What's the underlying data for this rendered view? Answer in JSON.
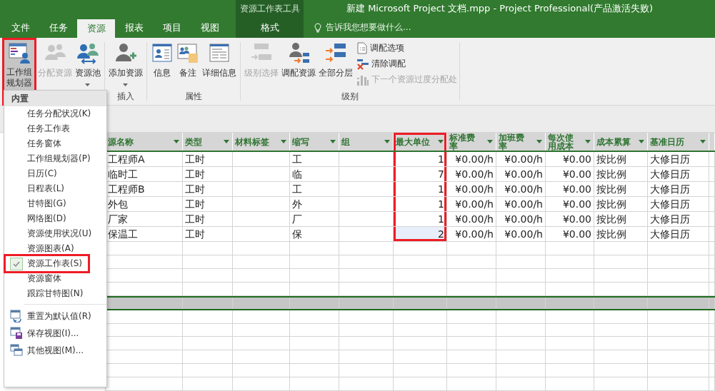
{
  "window": {
    "title": "新建 Microsoft Project 文档.mpp - Project Professional(产品激活失败)",
    "contextual_title": "资源工作表工具"
  },
  "tabs": [
    {
      "label": "文件",
      "selected": false,
      "contextual": false
    },
    {
      "label": "任务",
      "selected": false,
      "contextual": false
    },
    {
      "label": "资源",
      "selected": true,
      "contextual": false
    },
    {
      "label": "报表",
      "selected": false,
      "contextual": false
    },
    {
      "label": "项目",
      "selected": false,
      "contextual": false
    },
    {
      "label": "视图",
      "selected": false,
      "contextual": false
    },
    {
      "label": "格式",
      "selected": false,
      "contextual": true
    }
  ],
  "tell_me": {
    "placeholder": "告诉我您想要做什么..."
  },
  "ribbon": {
    "groups": [
      {
        "buttons": [
          {
            "label": "工作组规划器",
            "disabled": false,
            "dropdown": true,
            "highlighted": true
          },
          {
            "label": "分配资源",
            "disabled": true,
            "dropdown": false,
            "highlighted": false
          },
          {
            "label": "资源池",
            "disabled": false,
            "dropdown": true,
            "highlighted": false
          }
        ]
      },
      {
        "label": "插入",
        "buttons": [
          {
            "label": "添加资源",
            "disabled": false,
            "dropdown": true,
            "highlighted": false
          }
        ]
      },
      {
        "label": "属性",
        "buttons": [
          {
            "label": "信息",
            "disabled": false,
            "dropdown": false,
            "highlighted": false
          },
          {
            "label": "备注",
            "disabled": false,
            "dropdown": false,
            "highlighted": false
          },
          {
            "label": "详细信息",
            "disabled": false,
            "dropdown": false,
            "highlighted": false
          }
        ]
      },
      {
        "label": "级别",
        "buttons": [
          {
            "label": "级别选择",
            "disabled": true,
            "dropdown": false,
            "highlighted": false
          },
          {
            "label": "调配资源",
            "disabled": false,
            "dropdown": false,
            "highlighted": false
          },
          {
            "label": "全部分层",
            "disabled": false,
            "dropdown": false,
            "highlighted": false
          }
        ],
        "small_buttons": [
          {
            "label": "调配选项",
            "disabled": false
          },
          {
            "label": "清除调配",
            "disabled": false
          },
          {
            "label": "下一个资源过度分配处",
            "disabled": true
          }
        ]
      }
    ]
  },
  "menu": {
    "header": "内置",
    "items": [
      {
        "label": "任务分配状况(K)",
        "checked": false,
        "highlighted": false
      },
      {
        "label": "任务工作表",
        "checked": false,
        "highlighted": false
      },
      {
        "label": "任务窗体",
        "checked": false,
        "highlighted": false
      },
      {
        "label": "工作组规划器(P)",
        "checked": false,
        "highlighted": false
      },
      {
        "label": "日历(C)",
        "checked": false,
        "highlighted": false
      },
      {
        "label": "日程表(L)",
        "checked": false,
        "highlighted": false
      },
      {
        "label": "甘特图(G)",
        "checked": false,
        "highlighted": false
      },
      {
        "label": "网络图(D)",
        "checked": false,
        "highlighted": false
      },
      {
        "label": "资源使用状况(U)",
        "checked": false,
        "highlighted": false
      },
      {
        "label": "资源图表(A)",
        "checked": false,
        "highlighted": false
      },
      {
        "label": "资源工作表(S)",
        "checked": true,
        "highlighted": true
      },
      {
        "label": "资源窗体",
        "checked": false,
        "highlighted": false
      },
      {
        "label": "跟踪甘特图(N)",
        "checked": false,
        "highlighted": false
      }
    ],
    "commands": [
      {
        "label": "重置为默认值(R)"
      },
      {
        "label": "保存视图(I)..."
      },
      {
        "label": "其他视图(M)..."
      }
    ]
  },
  "table": {
    "columns": [
      {
        "label": "源名称",
        "numeric": false,
        "highlighted": false,
        "current": false
      },
      {
        "label": "类型",
        "numeric": false,
        "highlighted": false,
        "current": false
      },
      {
        "label": "材料标签",
        "numeric": false,
        "highlighted": false,
        "current": false
      },
      {
        "label": "缩写",
        "numeric": false,
        "highlighted": false,
        "current": false
      },
      {
        "label": "组",
        "numeric": false,
        "highlighted": false,
        "current": false
      },
      {
        "label": "最大单位",
        "numeric": true,
        "highlighted": true,
        "current": true
      },
      {
        "label": "标准费率",
        "numeric": true,
        "highlighted": false,
        "current": false
      },
      {
        "label": "加班费率",
        "numeric": true,
        "highlighted": false,
        "current": false
      },
      {
        "label": "每次使用成本",
        "numeric": true,
        "highlighted": false,
        "current": false
      },
      {
        "label": "成本累算",
        "numeric": false,
        "highlighted": false,
        "current": false
      },
      {
        "label": "基准日历",
        "numeric": false,
        "highlighted": false,
        "current": false
      }
    ],
    "rows": [
      {
        "selected": false,
        "cells": [
          "工程师A",
          "工时",
          "",
          "工",
          "",
          "1",
          "¥0.00/h",
          "¥0.00/h",
          "¥0.00",
          "按比例",
          "大修日历"
        ]
      },
      {
        "selected": false,
        "cells": [
          "临时工",
          "工时",
          "",
          "临",
          "",
          "7",
          "¥0.00/h",
          "¥0.00/h",
          "¥0.00",
          "按比例",
          "大修日历"
        ]
      },
      {
        "selected": false,
        "cells": [
          "工程师B",
          "工时",
          "",
          "工",
          "",
          "1",
          "¥0.00/h",
          "¥0.00/h",
          "¥0.00",
          "按比例",
          "大修日历"
        ]
      },
      {
        "selected": false,
        "cells": [
          "外包",
          "工时",
          "",
          "外",
          "",
          "1",
          "¥0.00/h",
          "¥0.00/h",
          "¥0.00",
          "按比例",
          "大修日历"
        ]
      },
      {
        "selected": false,
        "cells": [
          "厂家",
          "工时",
          "",
          "厂",
          "",
          "1",
          "¥0.00/h",
          "¥0.00/h",
          "¥0.00",
          "按比例",
          "大修日历"
        ]
      },
      {
        "selected": true,
        "cells": [
          "保温工",
          "工时",
          "",
          "保",
          "",
          "2",
          "¥0.00/h",
          "¥0.00/h",
          "¥0.00",
          "按比例",
          "大修日历"
        ]
      }
    ]
  }
}
